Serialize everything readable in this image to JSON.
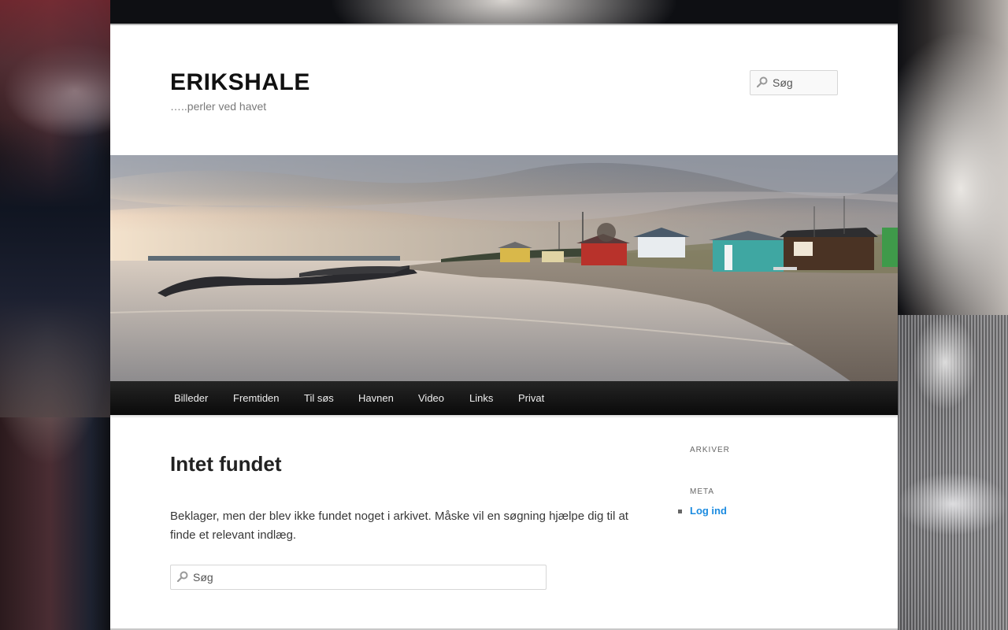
{
  "site": {
    "title": "ERIKSHALE",
    "description": "…..perler ved havet"
  },
  "header_search": {
    "placeholder": "Søg",
    "icon": "search-icon"
  },
  "header_image": {
    "alt": "Strand med badehuse ved solnedgang",
    "colors": {
      "sky_top": "#8d96a5",
      "sky_glow": "#f0d9c0",
      "water": "#b8b2ad",
      "sand": "#8a7f72",
      "hut_teal": "#3fa7a2",
      "hut_red": "#b8322b",
      "hut_yellow": "#d9b84a",
      "hut_brown": "#4a3324",
      "hut_green": "#3f9a4a"
    }
  },
  "nav": {
    "items": [
      {
        "label": "Billeder"
      },
      {
        "label": "Fremtiden"
      },
      {
        "label": "Til søs"
      },
      {
        "label": "Havnen"
      },
      {
        "label": "Video"
      },
      {
        "label": "Links"
      },
      {
        "label": "Privat"
      }
    ]
  },
  "content": {
    "title": "Intet fundet",
    "text": "Beklager, men der blev ikke fundet noget i arkivet. Måske vil en søgning hjælpe dig til at finde et relevant indlæg.",
    "search_placeholder": "Søg"
  },
  "sidebar": {
    "archives_title": "ARKIVER",
    "meta_title": "META",
    "meta_links": [
      {
        "label": "Log ind"
      }
    ]
  },
  "colors": {
    "link": "#1b8be0",
    "nav_bg": "#111111",
    "page_bg": "#ffffff"
  }
}
